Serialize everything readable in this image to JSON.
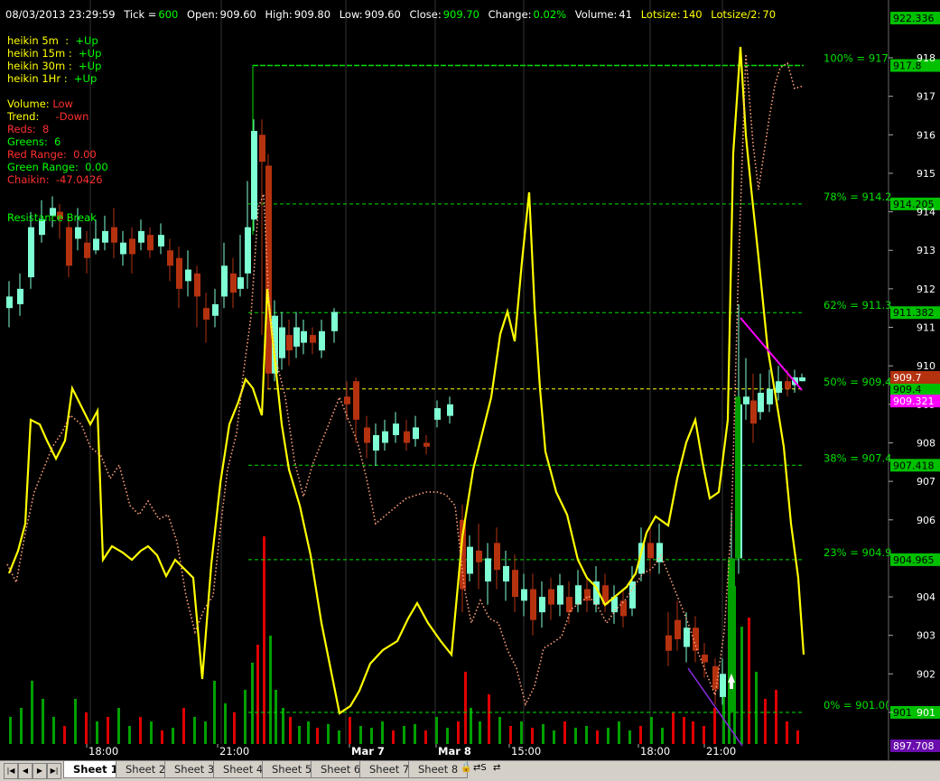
{
  "header": {
    "datetime": "08/03/2013 23:29:59",
    "tick_label": "Tick =",
    "tick_value": "600",
    "open_label": "Open:",
    "open_value": "909.60",
    "high_label": "High:",
    "high_value": "909.80",
    "low_label": "Low:",
    "low_value": "909.60",
    "close_label": "Close:",
    "close_value": "909.70",
    "change_label": "Change:",
    "change_value": "0.02%",
    "volume_label": "Volume:",
    "volume_value": "41",
    "lotsize_label": "Lotsize:",
    "lotsize_value": "140",
    "lotsize2_label": "Lotsize/2:",
    "lotsize2_value": "70"
  },
  "heikin": [
    {
      "label": "heikin 5m  :",
      "value": "+Up"
    },
    {
      "label": "heikin 15m :",
      "value": "+Up"
    },
    {
      "label": "heikin 30m :",
      "value": "+Up"
    },
    {
      "label": "heikin 1Hr :",
      "value": "+Up"
    }
  ],
  "stats": {
    "volume_label": "Volume:",
    "volume_value": "Low",
    "trend_label": "Trend:",
    "trend_value": "-Down",
    "reds": "Reds:  8",
    "greens": "Greens:  6",
    "red_range": "Red Range:  0.00",
    "green_range": "Green Range:  0.00",
    "chaikin": "Chaikin:  -47.0426",
    "signal": "Resistance Break"
  },
  "fib_levels": [
    {
      "label": "100% = 917",
      "price": 917.8,
      "box": "917.8"
    },
    {
      "label": "78% = 914.2",
      "price": 914.205,
      "box": "914.205"
    },
    {
      "label": "62% = 911.3",
      "price": 911.382,
      "box": "911.382"
    },
    {
      "label": "50% = 909.4",
      "price": 909.4,
      "box": "909.4"
    },
    {
      "label": "38% = 907.4",
      "price": 907.418,
      "box": "907.418"
    },
    {
      "label": "23% = 904.9",
      "price": 904.965,
      "box": "904.965"
    },
    {
      "label": "0% = 901.0(",
      "price": 901.0,
      "box": "901"
    }
  ],
  "price_axis": {
    "ticks": [
      "918",
      "917",
      "916",
      "915",
      "914",
      "913",
      "912",
      "911",
      "910",
      "909",
      "908",
      "907",
      "906",
      "904",
      "903",
      "902",
      "901"
    ],
    "top_box": "922.336",
    "bottom_box": "897.708",
    "last_box": "909.7",
    "magenta_box": "909.321"
  },
  "time_axis": [
    "18:00",
    "21:00",
    "Mar 7",
    "Mar 8",
    "15:00",
    "18:00",
    "21:00"
  ],
  "tabs": [
    "Sheet 1",
    "Sheet 2",
    "Sheet 3",
    "Sheet 4",
    "Sheet 5",
    "Sheet 6",
    "Sheet 7",
    "Sheet 8"
  ],
  "colors": {
    "bull": "#7fffd4",
    "bear": "#b5320f",
    "fib": "#00e000",
    "yellow": "#ffff00",
    "dotted": "#ffa07a",
    "magenta": "#ff00ff",
    "vol_green": "#00a000",
    "vol_red": "#e00000"
  }
}
